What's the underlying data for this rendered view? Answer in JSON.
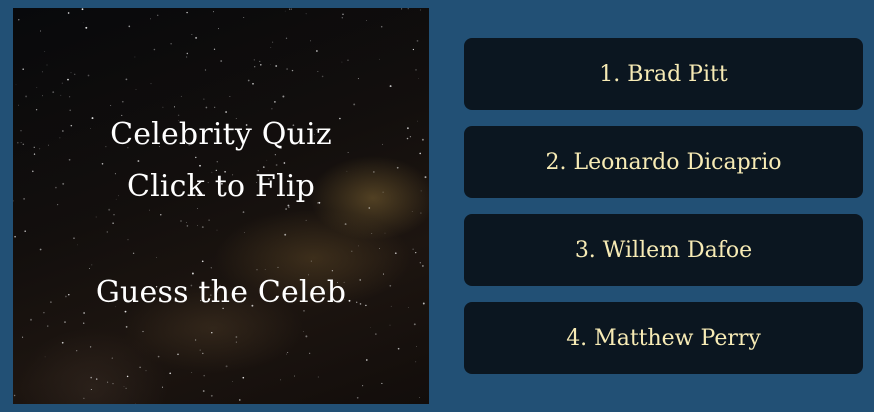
{
  "card": {
    "title": "Celebrity Quiz",
    "subtitle": "Click to Flip",
    "prompt": "Guess the Celeb"
  },
  "answers": [
    {
      "label": "1. Brad Pitt"
    },
    {
      "label": "2. Leonardo Dicaprio"
    },
    {
      "label": "3. Willem Dafoe"
    },
    {
      "label": "4. Matthew Perry"
    }
  ],
  "colors": {
    "page_background": "#225075",
    "answer_background": "#0b1620",
    "answer_text": "#f7ebb5",
    "card_text": "#ffffff"
  }
}
